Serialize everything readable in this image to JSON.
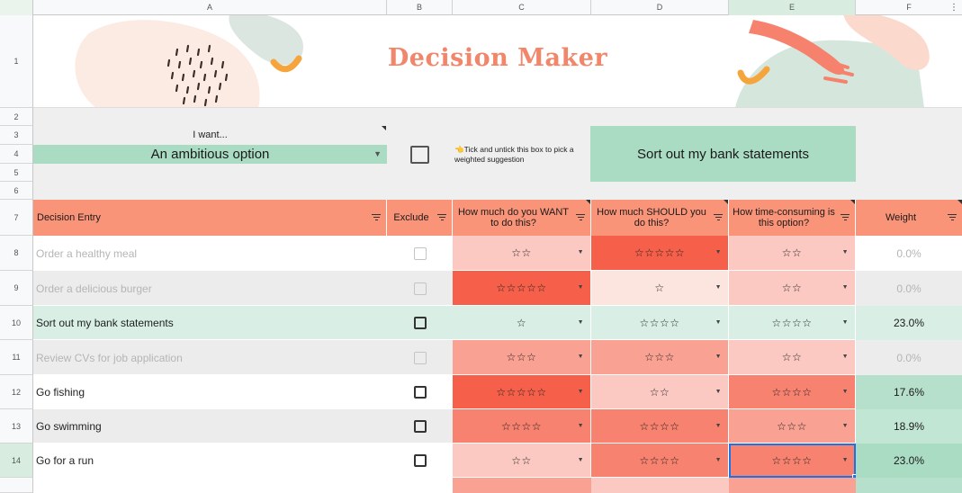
{
  "columns": [
    "A",
    "B",
    "C",
    "D",
    "E",
    "F"
  ],
  "rows_visible": [
    "1",
    "2",
    "3",
    "4",
    "5",
    "6",
    "7",
    "8",
    "9",
    "10",
    "11",
    "12",
    "13",
    "14"
  ],
  "title": "Decision Maker",
  "want_label": "I want...",
  "want_value": "An ambitious option",
  "tick_hint": "👈Tick and untick this box to pick a weighted suggestion",
  "suggestion": "Sort out my bank statements",
  "headers": {
    "entry": "Decision Entry",
    "exclude": "Exclude",
    "want": "How much do you WANT to do this?",
    "should": "How much SHOULD you do this?",
    "time": "How time-consuming is this option?",
    "weight": "Weight"
  },
  "colors": {
    "accent": "#fa9479",
    "mint": "#a9dcc3",
    "title": "#f2866a",
    "rating_1": "#fde5df",
    "rating_2": "#fcc9c2",
    "rating_3": "#f9a293",
    "rating_4": "#f7826f",
    "rating_5": "#f6604a"
  },
  "entries": [
    {
      "name": "Order a healthy meal",
      "excluded": true,
      "want": "☆☆",
      "should": "☆☆☆☆☆",
      "time": "☆☆",
      "weight": "0.0%"
    },
    {
      "name": "Order a delicious burger",
      "excluded": true,
      "want": "☆☆☆☆☆",
      "should": "☆",
      "time": "☆☆",
      "weight": "0.0%"
    },
    {
      "name": "Sort out my bank statements",
      "excluded": false,
      "want": "☆",
      "should": "☆☆☆☆",
      "time": "☆☆☆☆",
      "weight": "23.0%"
    },
    {
      "name": "Review CVs for job application",
      "excluded": true,
      "want": "☆☆☆",
      "should": "☆☆☆",
      "time": "☆☆",
      "weight": "0.0%"
    },
    {
      "name": "Go fishing",
      "excluded": false,
      "want": "☆☆☆☆☆",
      "should": "☆☆",
      "time": "☆☆☆☆",
      "weight": "17.6%"
    },
    {
      "name": "Go swimming",
      "excluded": false,
      "want": "☆☆☆☆",
      "should": "☆☆☆☆",
      "time": "☆☆☆",
      "weight": "18.9%"
    },
    {
      "name": "Go for a run",
      "excluded": false,
      "want": "☆☆",
      "should": "☆☆☆☆",
      "time": "☆☆☆☆",
      "weight": "23.0%"
    }
  ]
}
